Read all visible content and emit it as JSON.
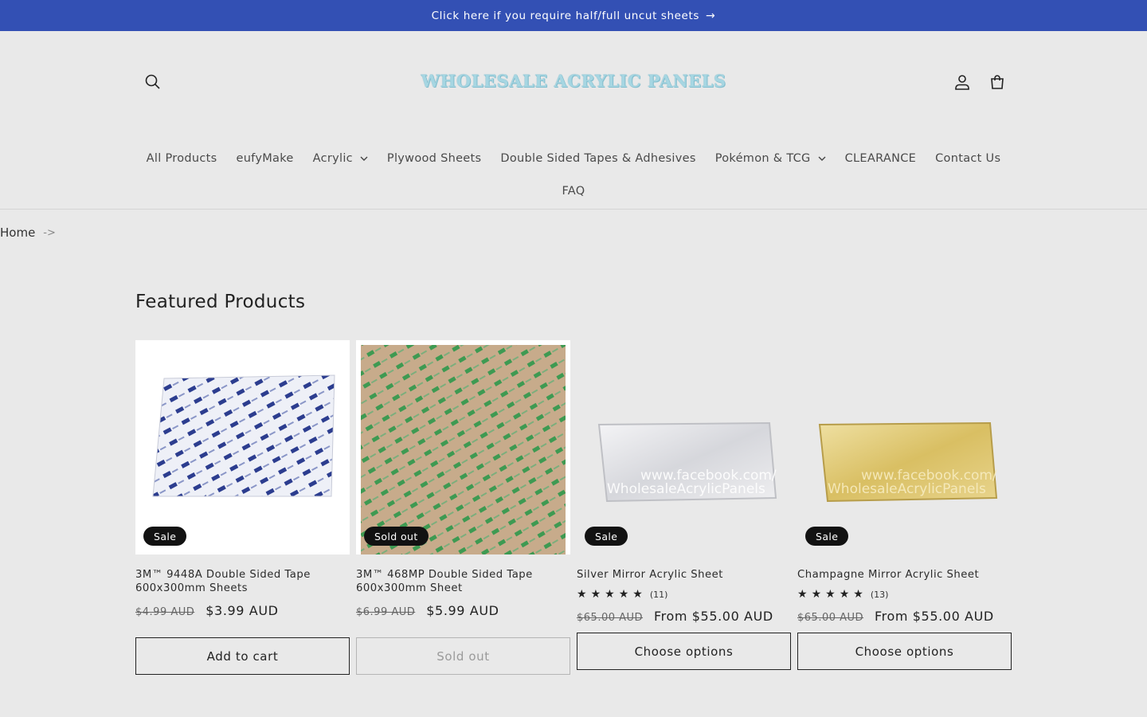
{
  "announcement": {
    "text": "Click here if you require half/full uncut sheets",
    "arrow": "→"
  },
  "header": {
    "logo_text": "WHOLESALE ACRYLIC PANELS",
    "icons": {
      "search": "search-icon",
      "account": "account-icon",
      "cart": "cart-icon"
    }
  },
  "nav": {
    "items": [
      {
        "label": "All Products",
        "has_dropdown": false
      },
      {
        "label": "eufyMake",
        "has_dropdown": false
      },
      {
        "label": "Acrylic",
        "has_dropdown": true
      },
      {
        "label": "Plywood Sheets",
        "has_dropdown": false
      },
      {
        "label": "Double Sided Tapes & Adhesives",
        "has_dropdown": false
      },
      {
        "label": "Pokémon & TCG",
        "has_dropdown": true
      },
      {
        "label": "CLEARANCE",
        "has_dropdown": false
      },
      {
        "label": "Contact Us",
        "has_dropdown": false
      }
    ],
    "row2": [
      {
        "label": "FAQ"
      }
    ]
  },
  "breadcrumb": {
    "home": "Home",
    "separator": "->"
  },
  "section": {
    "title": "Featured Products"
  },
  "products": [
    {
      "title": "3M™ 9448A Double Sided Tape 600x300mm Sheets",
      "badge": "Sale",
      "old_price": "$4.99 AUD",
      "price": "$3.99 AUD",
      "button": "Add to cart",
      "button_disabled": false,
      "rating": null,
      "image": "tape-blue"
    },
    {
      "title": "3M™ 468MP Double Sided Tape 600x300mm Sheet",
      "badge": "Sold out",
      "old_price": "$6.99 AUD",
      "price": "$5.99 AUD",
      "button": "Sold out",
      "button_disabled": true,
      "rating": null,
      "image": "tape-green"
    },
    {
      "title": "Silver Mirror Acrylic Sheet",
      "badge": "Sale",
      "old_price": "$65.00 AUD",
      "price": "From $55.00 AUD",
      "button": "Choose options",
      "button_disabled": false,
      "rating": {
        "stars": 5,
        "count": "(11)"
      },
      "image": "mirror-silver",
      "watermark": [
        "www.facebook.com/",
        "WholesaleAcrylicPanels"
      ]
    },
    {
      "title": "Champagne Mirror Acrylic Sheet",
      "badge": "Sale",
      "old_price": "$65.00 AUD",
      "price": "From $55.00 AUD",
      "button": "Choose options",
      "button_disabled": false,
      "rating": {
        "stars": 5,
        "count": "(13)"
      },
      "image": "mirror-gold",
      "watermark": [
        "www.facebook.com/",
        "WholesaleAcrylicPanels"
      ]
    }
  ],
  "colors": {
    "announcement_bg": "#3350b4",
    "page_bg": "#e9e9e9",
    "badge_bg": "#121212",
    "logo": "#a6d6e2"
  }
}
